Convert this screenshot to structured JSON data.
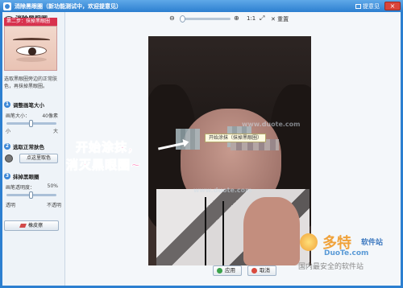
{
  "window": {
    "title": "消除黑眼圈（新功能测试中，欢迎提意见）",
    "feedback": "提意见",
    "close": "×"
  },
  "panel": {
    "heading": "消除黑眼圈",
    "step_tag": "第二步：抹掉黑眼圈",
    "description": "选取黑眼圈旁边的正常肤色，再抹掉黑眼圈。",
    "sections": [
      {
        "num": "1",
        "title": "调整画笔大小",
        "field_label": "画笔大小：",
        "field_value": "40像素",
        "min_label": "小",
        "max_label": "大",
        "value": 0.5
      },
      {
        "num": "2",
        "title": "选取正常肤色",
        "button": "点这里取色"
      },
      {
        "num": "3",
        "title": "抹掉黑眼圈",
        "field_label": "画笔透明度：",
        "field_value": "50%",
        "min_label": "透明",
        "max_label": "不透明",
        "value": 0.5
      }
    ],
    "eraser_button": "橡皮擦"
  },
  "toolbar": {
    "zoom_out": "⊖",
    "zoom_in": "⊕",
    "ratio": "1:1",
    "fit": "⤢",
    "reset": "重置",
    "zoom_value": 0.0
  },
  "canvas": {
    "tooltip": "开始涂抹（抹掉黑眼圈）",
    "overlay_line1": "开始涂抹，",
    "overlay_line2": "消灭黑眼圈~",
    "watermark": "www.duote.com"
  },
  "buttons": {
    "ok": "应用",
    "cancel": "取消"
  },
  "logo": {
    "brand": "多特",
    "sub": "软件站",
    "url": "DuoTe.com",
    "tag": "国内最安全的软件站"
  },
  "colors": {
    "accent": "#2c7fd0",
    "step": "#d8324e",
    "overlay": "#ff7fb8"
  }
}
